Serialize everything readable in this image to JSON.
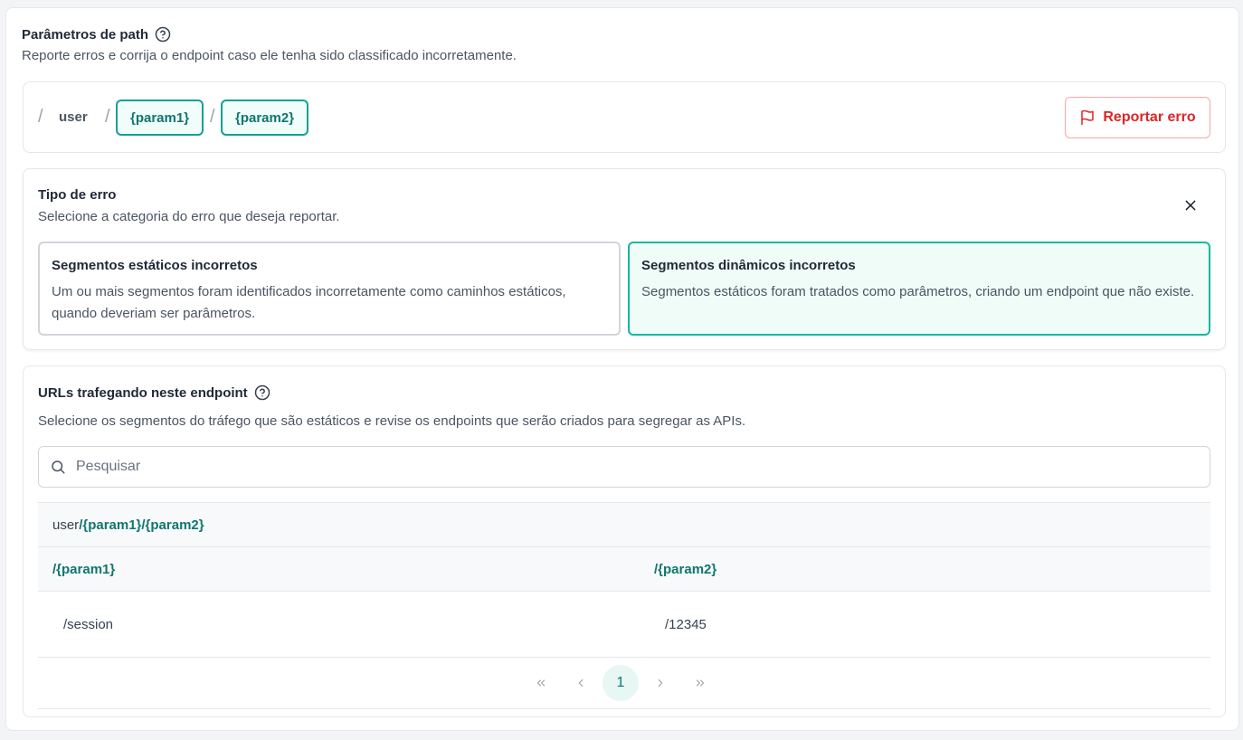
{
  "header": {
    "title": "Parâmetros de path",
    "description": "Reporte erros e corrija o endpoint caso ele tenha sido classificado incorretamente."
  },
  "path": {
    "separator": "/",
    "static_segment": "user",
    "params": [
      "{param1}",
      "{param2}"
    ],
    "report_button_label": "Reportar erro"
  },
  "error_type": {
    "title": "Tipo de erro",
    "description": "Selecione a categoria do erro que deseja reportar.",
    "options": [
      {
        "title": "Segmentos estáticos incorretos",
        "description": "Um ou mais segmentos foram identificados incorretamente como caminhos estáticos, quando deveriam ser parâmetros.",
        "selected": false
      },
      {
        "title": "Segmentos dinâmicos incorretos",
        "description": "Segmentos estáticos foram tratados como parâmetros, criando um endpoint que não existe.",
        "selected": true
      }
    ]
  },
  "urls": {
    "title": "URLs trafegando neste endpoint",
    "description": "Selecione os segmentos do tráfego que são estáticos e revise os endpoints que serão criados para segregar as APIs.",
    "search_placeholder": "Pesquisar",
    "endpoint_static": "user",
    "endpoint_params": "/{param1}/{param2}",
    "columns": [
      "/{param1}",
      "/{param2}"
    ],
    "rows": [
      [
        "/session",
        "/12345"
      ]
    ],
    "pagination": {
      "current_page": "1"
    }
  },
  "colors": {
    "accent": "#14a096",
    "accent_text": "#0f766e",
    "danger": "#dc2626",
    "selected_bg": "#effcf8"
  }
}
